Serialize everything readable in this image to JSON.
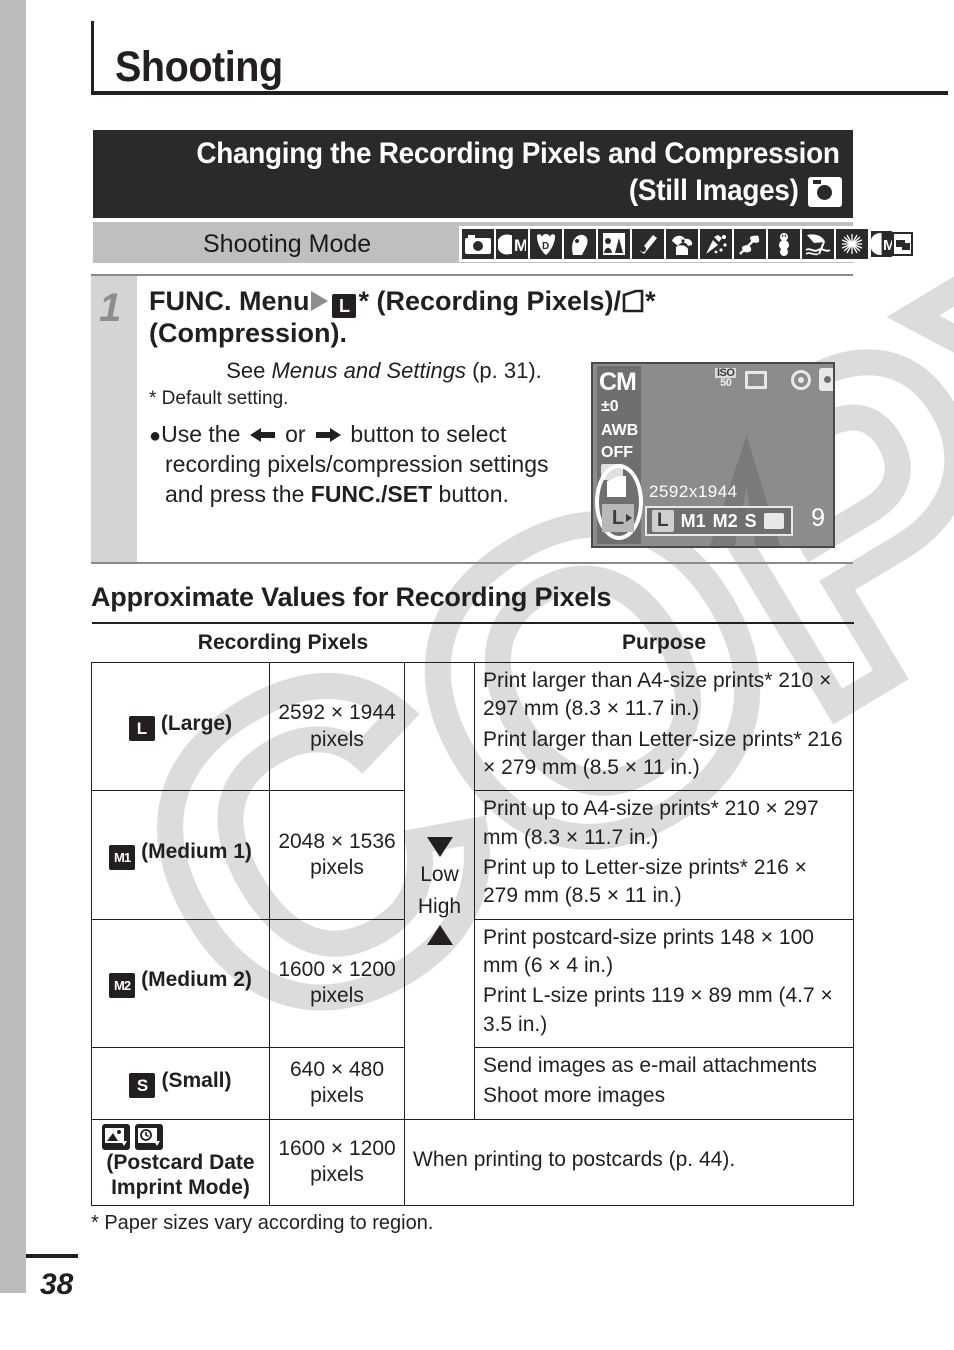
{
  "chapter": {
    "title": "Shooting"
  },
  "banner": {
    "line1": "Changing the Recording Pixels and Compression",
    "line2": "(Still Images)",
    "icon": "still-camera-icon"
  },
  "mode_bar": {
    "label": "Shooting Mode",
    "icons": [
      "auto-camera-icon",
      "creative-manual-icon",
      "digital-macro-icon",
      "portrait-icon",
      "night-scene-icon",
      "night-snapshot-icon",
      "kids-and-pets-icon",
      "indoor-icon",
      "foliage-icon",
      "snow-icon",
      "beach-icon",
      "fireworks-icon",
      "stitch-assist-icon"
    ]
  },
  "step1": {
    "number": "1",
    "heading_pre": "FUNC. Menu",
    "heading_l_glyph": "L",
    "heading_mid": "* (Recording Pixels)/",
    "heading_post": "* (Compression).",
    "see_pre": "See ",
    "see_italic": "Menus and Settings",
    "see_post": " (p. 31).",
    "default_note": "* Default setting.",
    "bullet_1": "Use the ",
    "bullet_2": " or ",
    "bullet_3": " button to select recording pixels/compression settings and press the ",
    "bullet_bold": "FUNC./SET",
    "bullet_4": " button."
  },
  "lcd": {
    "mode": "CM",
    "exposure": "±0",
    "white_balance": "AWB",
    "flash": "OFF",
    "iso_label": "ISO",
    "iso_value": "50",
    "resolution": "2592x1944",
    "selected": "L",
    "options": [
      "L",
      "M1",
      "M2",
      "S"
    ],
    "postcard_option": "postcard-icon",
    "shots_remaining": "9",
    "icons": [
      "frame-icon",
      "red-eye-icon",
      "camera-shake-icon",
      "drive-mode-icon"
    ]
  },
  "sub_heading": "Approximate Values for Recording Pixels",
  "table": {
    "headers": [
      "Recording Pixels",
      "Purpose"
    ],
    "quality_high": "High",
    "quality_low": "Low",
    "rows": [
      {
        "symbol": "L",
        "symbol_name": "large-icon",
        "name": "(Large)",
        "pixels": "2592 × 1944",
        "pixels_unit": "pixels",
        "purpose": [
          "Print larger than A4-size prints* 210 × 297 mm (8.3 × 11.7 in.)",
          "Print larger than Letter-size prints* 216 × 279 mm (8.5 × 11 in.)"
        ]
      },
      {
        "symbol": "M1",
        "symbol_name": "medium1-icon",
        "name": "(Medium 1)",
        "pixels": "2048 × 1536",
        "pixels_unit": "pixels",
        "purpose": [
          "Print up to A4-size prints* 210 × 297 mm (8.3 × 11.7 in.)",
          "Print up to Letter-size prints* 216 × 279 mm (8.5 × 11 in.)"
        ]
      },
      {
        "symbol": "M2",
        "symbol_name": "medium2-icon",
        "name": "(Medium 2)",
        "pixels": "1600 × 1200",
        "pixels_unit": "pixels",
        "purpose": [
          "Print postcard-size prints 148 × 100 mm (6 × 4 in.)",
          "Print L-size prints 119 × 89 mm (4.7 × 3.5 in.)"
        ]
      },
      {
        "symbol": "S",
        "symbol_name": "small-icon",
        "name": "(Small)",
        "pixels": "640 × 480",
        "pixels_unit": "pixels",
        "purpose": [
          "Send images as e-mail attachments",
          "Shoot more images"
        ]
      }
    ],
    "postcard_row": {
      "icon_a": "postcard-imprint-icon",
      "icon_b": "date-imprint-icon",
      "name_line1": "(Postcard Date",
      "name_line2": "Imprint Mode)",
      "pixels": "1600 × 1200",
      "pixels_unit": "pixels",
      "purpose": "When printing to postcards (p. 44)."
    }
  },
  "footnote": "*  Paper sizes vary according to region.",
  "folio": "38",
  "watermark_text": "COPY",
  "colors": {
    "banner_bg": "#2a2a2a",
    "mode_bar_bg": "#bfbfbf",
    "step_gutter": "#d4d4d4",
    "edge_strip": "#bcbcbc",
    "ink": "#231f20"
  }
}
